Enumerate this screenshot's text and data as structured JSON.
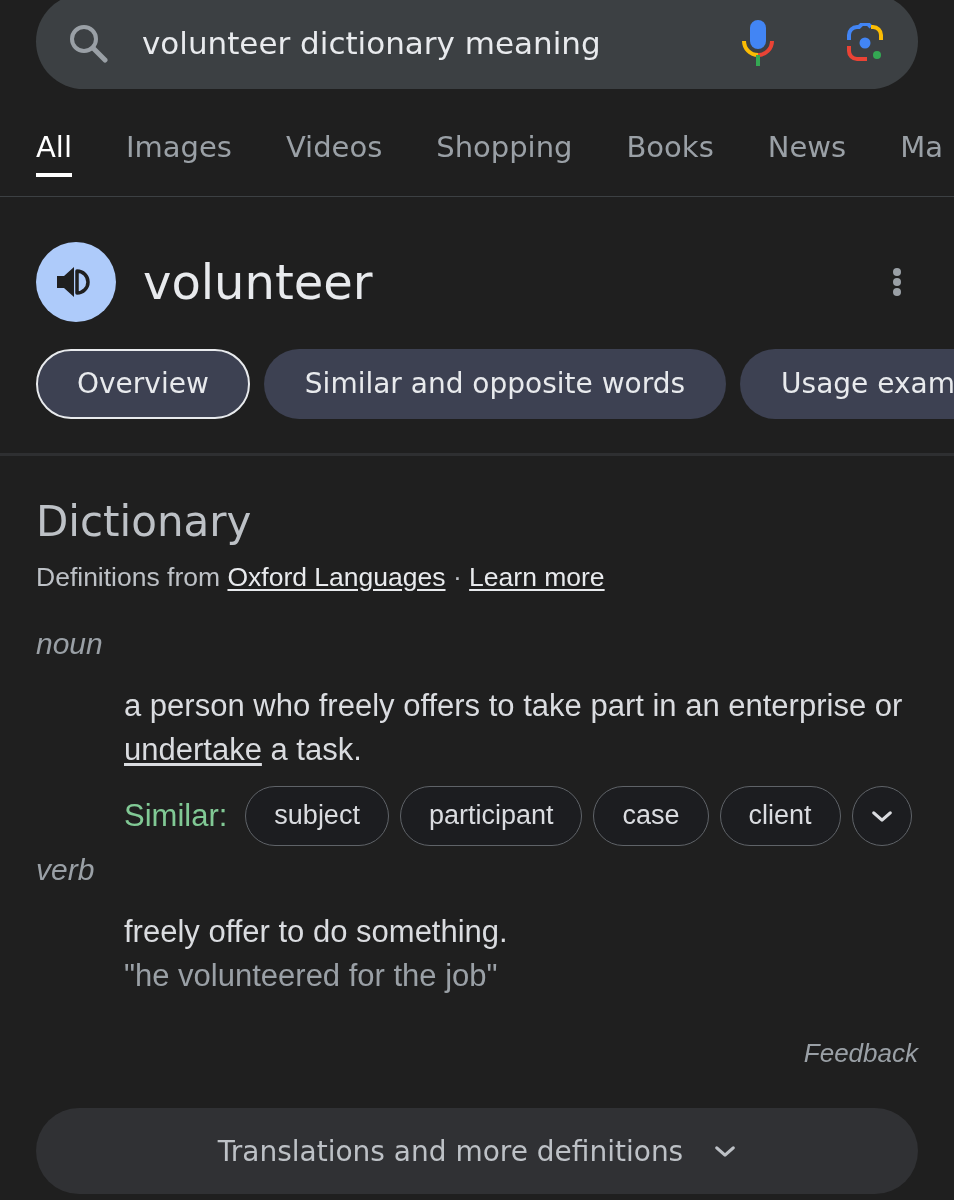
{
  "search": {
    "value": "volunteer dictionary meaning"
  },
  "tabs": [
    {
      "label": "All",
      "selected": true
    },
    {
      "label": "Images",
      "selected": false
    },
    {
      "label": "Videos",
      "selected": false
    },
    {
      "label": "Shopping",
      "selected": false
    },
    {
      "label": "Books",
      "selected": false
    },
    {
      "label": "News",
      "selected": false
    },
    {
      "label": "Ma",
      "selected": false
    }
  ],
  "entry": {
    "word": "volunteer"
  },
  "chips": [
    {
      "label": "Overview",
      "selected": true
    },
    {
      "label": "Similar and opposite words",
      "selected": false
    },
    {
      "label": "Usage exam",
      "selected": false
    }
  ],
  "dictionary": {
    "title": "Dictionary",
    "source": {
      "prefix": "Definitions from",
      "source_link": "Oxford Languages",
      "separator": "·",
      "learn_more_link": "Learn more"
    },
    "senses": [
      {
        "part_of_speech": "noun",
        "definition": {
          "before": "a person who freely offers to take part in an enterprise or",
          "link": "undertake",
          "after": "a task."
        },
        "similar": {
          "label": "Similar:",
          "words": [
            "subject",
            "participant",
            "case",
            "client"
          ]
        }
      },
      {
        "part_of_speech": "verb",
        "definition": {
          "before": "freely offer to do something."
        },
        "example": "\"he volunteered for the job\""
      }
    ],
    "feedback": "Feedback"
  },
  "more_button": {
    "label": "Translations and more definitions"
  }
}
